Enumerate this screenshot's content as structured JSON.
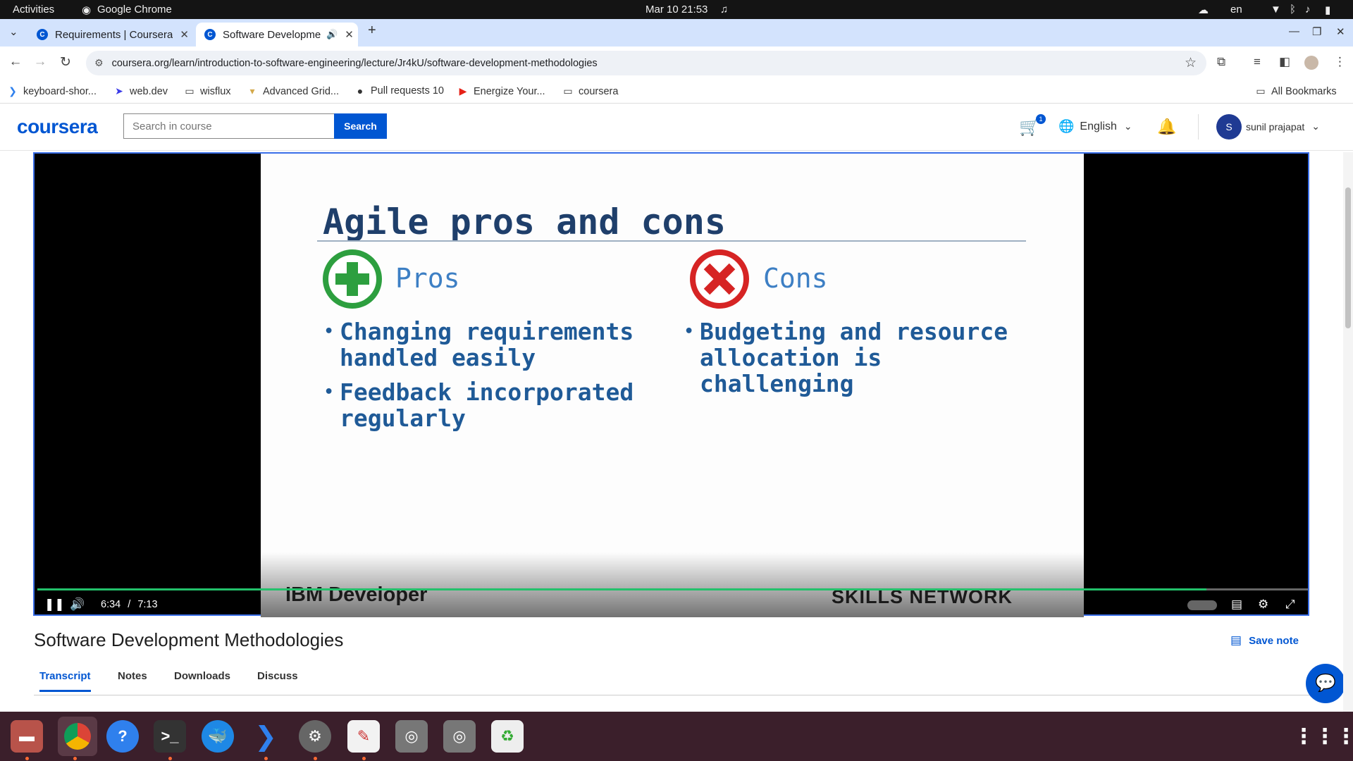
{
  "system": {
    "activities": "Activities",
    "app_name": "Google Chrome",
    "datetime": "Mar 10  21:53",
    "lang_indicator": "en"
  },
  "browser": {
    "tabs": [
      {
        "title": "Requirements | Coursera"
      },
      {
        "title": "Software Developme"
      }
    ],
    "url": "coursera.org/learn/introduction-to-software-engineering/lecture/Jr4kU/software-development-methodologies",
    "bookmarks": [
      {
        "label": "keyboard-shor...",
        "icon": "vscode-icon"
      },
      {
        "label": "web.dev",
        "icon": "webdev-icon"
      },
      {
        "label": "wisflux",
        "icon": "folder-icon"
      },
      {
        "label": "Advanced Grid...",
        "icon": "grid-icon"
      },
      {
        "label": "Pull requests 10",
        "icon": "github-icon"
      },
      {
        "label": "Energize Your...",
        "icon": "youtube-icon"
      },
      {
        "label": "coursera",
        "icon": "folder-icon"
      }
    ],
    "all_bookmarks": "All Bookmarks"
  },
  "coursera": {
    "logo": "coursera",
    "search_placeholder": "Search in course",
    "search_button": "Search",
    "cart_count": "1",
    "language": "English",
    "user_initial": "S",
    "user_name": "sunil prajapat"
  },
  "video": {
    "slide": {
      "title": "Agile pros and cons",
      "pros_heading": "Pros",
      "pros": [
        {
          "line1": "Changing requirements",
          "line2": "handled easily"
        },
        {
          "line1": "Feedback incorporated",
          "line2": "regularly"
        }
      ],
      "cons_heading": "Cons",
      "cons": [
        {
          "line1": "Budgeting and resource",
          "line2": "allocation is",
          "line3": "challenging"
        }
      ],
      "footer_left": "IBM Developer",
      "footer_right": "SKILLS NETWORK"
    },
    "time_current": "6:34",
    "time_separator": "/",
    "time_total": "7:13",
    "progress_fraction": 0.92
  },
  "lecture": {
    "title": "Software Development Methodologies",
    "save_note": "Save note",
    "tabs": [
      {
        "label": "Transcript"
      },
      {
        "label": "Notes"
      },
      {
        "label": "Downloads"
      },
      {
        "label": "Discuss"
      }
    ]
  },
  "colors": {
    "brand": "#0056d2",
    "progress": "#23c16b",
    "pros_green": "#2d9f3f",
    "cons_red": "#d62424",
    "dock_bg": "#3b1f2b"
  }
}
